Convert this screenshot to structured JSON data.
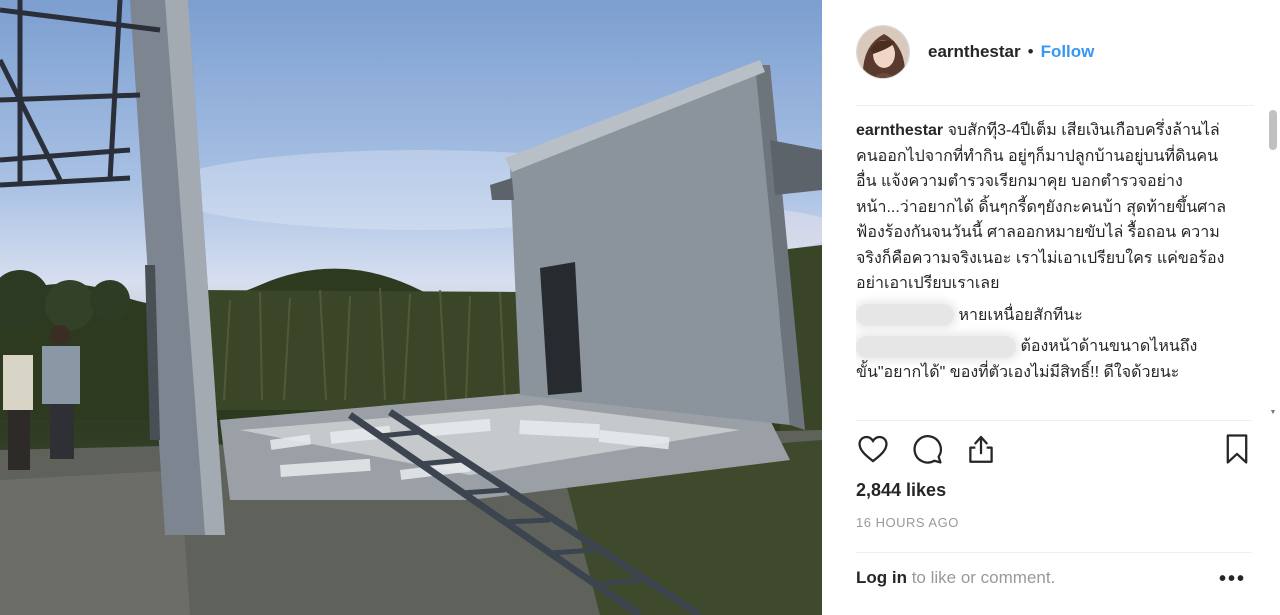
{
  "post": {
    "username": "earnthestar",
    "separator": "•",
    "follow_label": "Follow",
    "caption_text": "จบสักทีุ3-4ปีเต็ม เสียเงินเกือบครึ่งล้านไล่คนออกไปจากที่ทำกิน อยู่ๆก็มาปลูกบ้านอยู่บนที่ดินคนอื่น แจ้งความตำรวจเรียกมาคุย บอกตำรวจอย่างหน้า...ว่าอยากได้ ดิ้นๆกรี้ดๆยังกะคนบ้า สุดท้ายขึ้นศาลฟ้องร้องกันจนวันนี้ ศาลออกหมายขับไล่ รื้อถอน ความจริงก็คือความจริงเนอะ เราไม่เอาเปรียบใคร แค่ขอร้องอย่าเอาเปรียบเราเลย",
    "comments": [
      {
        "text": "หายเหนื่อยสักทีนะ"
      },
      {
        "text": "ต้องหน้าด้านขนาดไหนถึงขั้น\"อยากได้\" ของที่ตัวเองไม่มีสิทธิ์!! ดีใจด้วยนะ"
      }
    ],
    "likes": "2,844 likes",
    "timestamp": "16 HOURS AGO",
    "login_link": "Log in",
    "login_suffix": " to like or comment.",
    "more_label": "•••"
  },
  "icons": {
    "like": "heart-icon",
    "comment": "speech-bubble-icon",
    "share": "share-icon",
    "save": "bookmark-icon"
  },
  "colors": {
    "accent": "#3897f0",
    "text": "#262626",
    "muted": "#999999",
    "divider": "#efefef"
  }
}
